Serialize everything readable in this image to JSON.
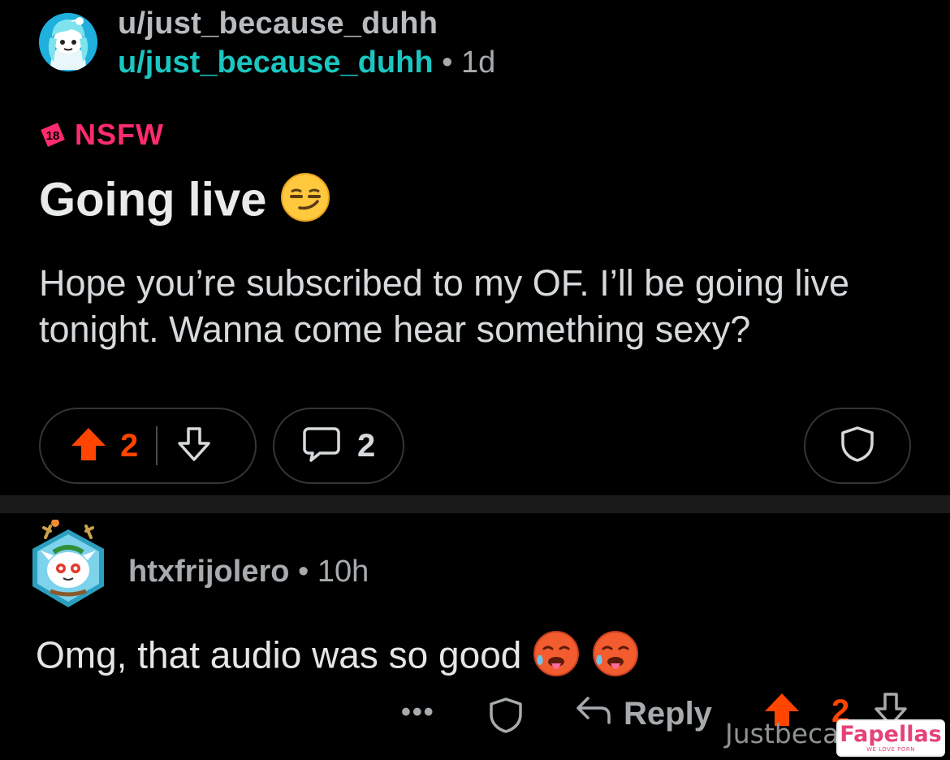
{
  "post": {
    "subreddit": "u/just_because_duhh",
    "author": "u/just_because_duhh",
    "separator": "•",
    "age": "1d",
    "nsfw_badge": "18",
    "nsfw_label": "NSFW",
    "title": "Going live",
    "title_emoji": "smirking-face",
    "body": "Hope you’re subscribed to my OF. I’ll be going live tonight. Wanna come hear something sexy?",
    "upvotes": "2",
    "comments": "2"
  },
  "comment": {
    "author": "htxfrijolero",
    "separator": "•",
    "age": "10h",
    "body": "Omg, that audio was so good",
    "body_emojis": [
      "hot-face",
      "hot-face"
    ],
    "more_label": "•••",
    "reply_label": "Reply",
    "upvotes": "2"
  },
  "watermark": {
    "text": "Justbeca",
    "brand": "Fapellas",
    "tagline": "WE LOVE PORN"
  },
  "colors": {
    "background": "#000000",
    "upvote": "#ff4500",
    "nsfw": "#ff2b6d",
    "username_link": "#1bc6c1",
    "muted": "#a7abae"
  }
}
